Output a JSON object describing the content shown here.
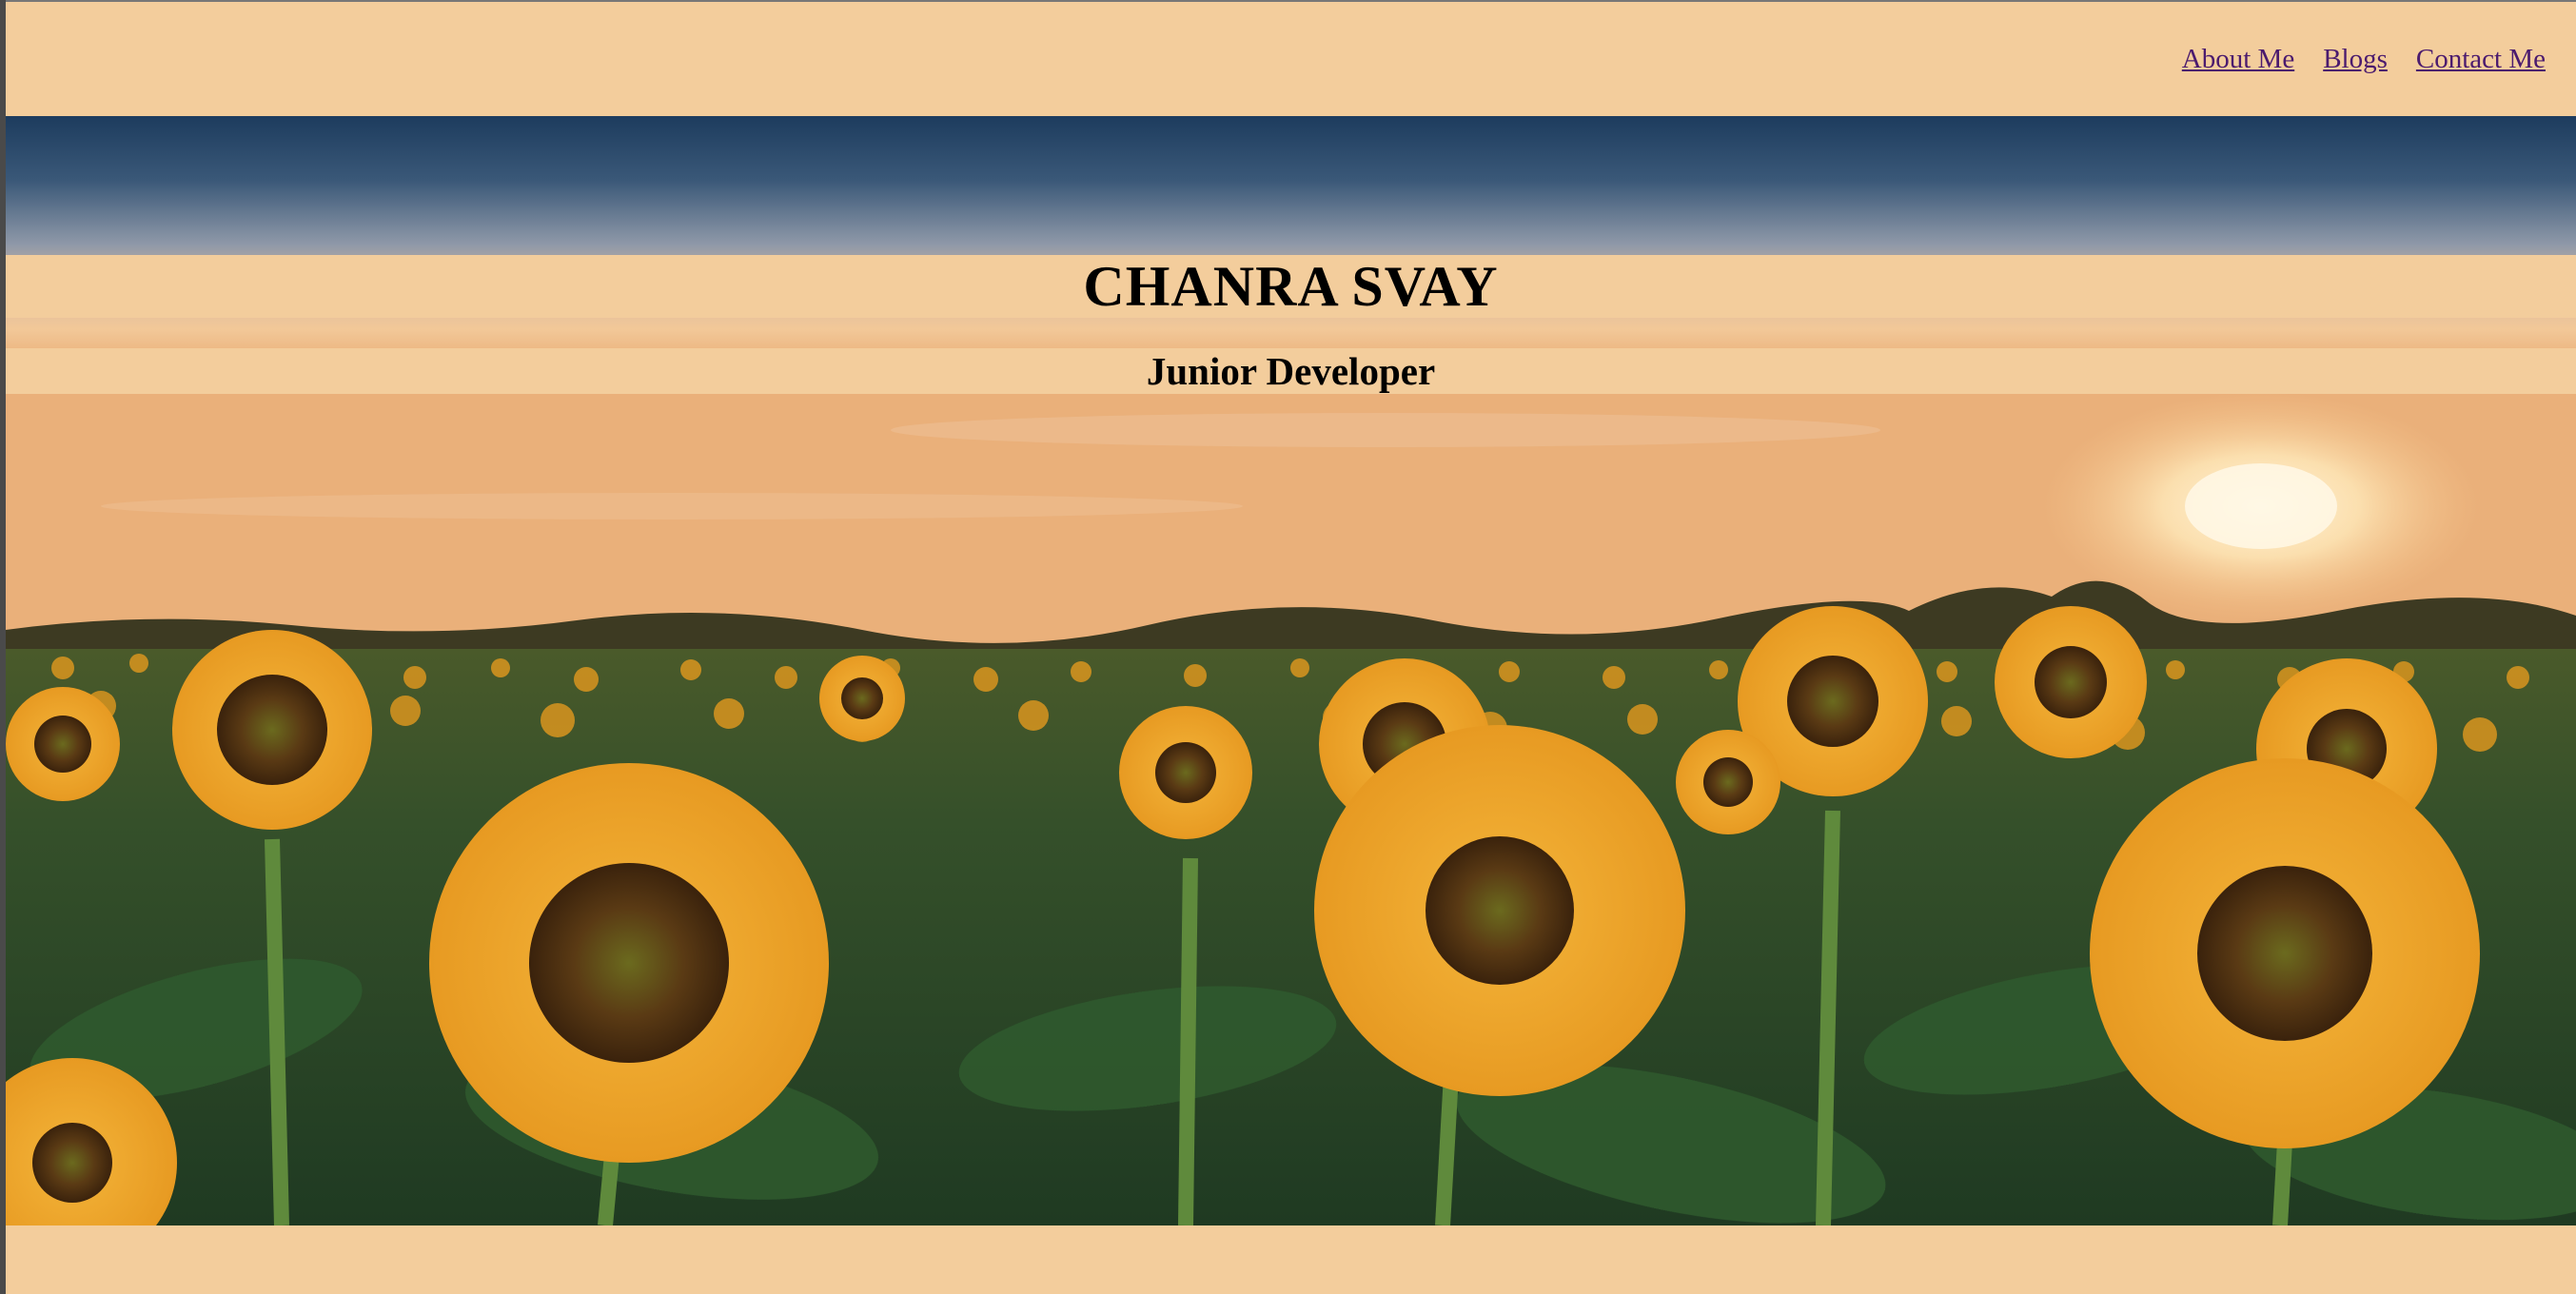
{
  "nav": {
    "items": [
      {
        "label": "About Me"
      },
      {
        "label": "Blogs"
      },
      {
        "label": "Contact Me"
      }
    ]
  },
  "hero": {
    "name": "CHANRA SVAY",
    "role": "Junior Developer",
    "background_image": "sunflower-field-at-sunset"
  },
  "colors": {
    "page_background": "#f3cd9c",
    "link": "#4b1b6e",
    "heading": "#000000"
  }
}
